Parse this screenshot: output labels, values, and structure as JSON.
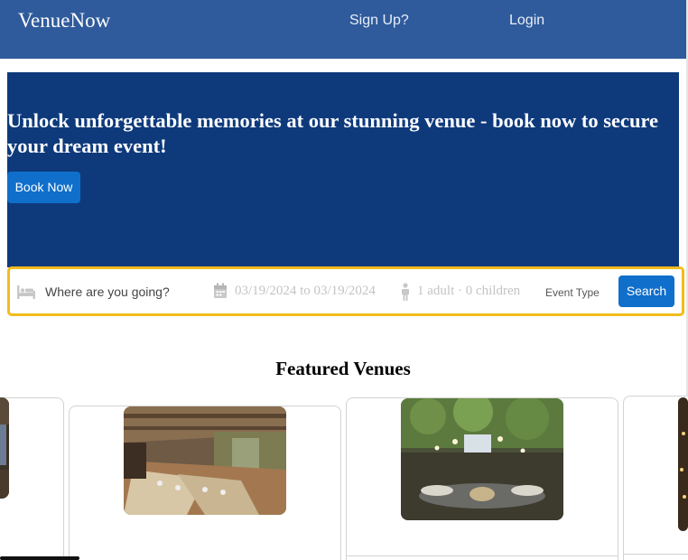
{
  "navbar": {
    "brand": "VenueNow",
    "signup_label": "Sign Up?",
    "login_label": "Login"
  },
  "hero": {
    "headline": "Unlock unforgettable memories at our stunning venue - book now to secure your dream event!",
    "book_label": "Book Now"
  },
  "search": {
    "destination_placeholder": "Where are you going?",
    "dates": "03/19/2024 to 03/19/2024",
    "guests": "1 adult · 0 children",
    "event_type": "Event Type",
    "search_label": "Search",
    "icons": [
      "bed-icon",
      "calendar-icon",
      "person-icon"
    ],
    "border_color": "#f3bb1b"
  },
  "featured": {
    "title": "Featured Venues"
  },
  "colors": {
    "navbar": "#2f5b9c",
    "hero": "#0e3a7c",
    "button": "#0f6fcb",
    "search_border": "#f3bb1b"
  }
}
